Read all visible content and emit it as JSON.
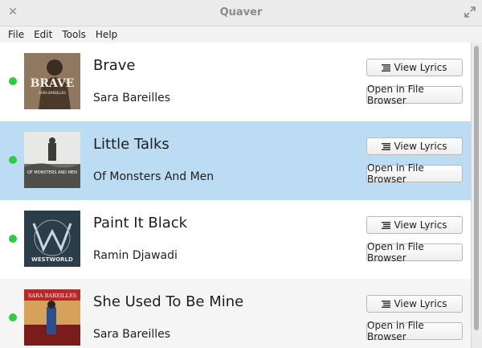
{
  "window": {
    "title": "Quaver"
  },
  "menu": [
    "File",
    "Edit",
    "Tools",
    "Help"
  ],
  "buttons": {
    "view_lyrics": "View Lyrics",
    "open_browser": "Open in File Browser"
  },
  "songs": [
    {
      "title": "Brave",
      "artist": "Sara Bareilles",
      "cover_text": "BRAVE",
      "cover_sub": "SARA BAREILLES",
      "status_color": "#2ecc40"
    },
    {
      "title": "Little Talks",
      "artist": "Of Monsters And Men",
      "cover_text": "OF MONSTERS AND MEN",
      "cover_sub": "",
      "status_color": "#2ecc40"
    },
    {
      "title": "Paint It Black",
      "artist": "Ramin Djawadi",
      "cover_text": "WESTWORLD",
      "cover_sub": "",
      "status_color": "#2ecc40"
    },
    {
      "title": "She Used To Be Mine",
      "artist": "Sara Bareilles",
      "cover_text": "SARA BAREILLES",
      "cover_sub": "",
      "status_color": "#2ecc40"
    }
  ],
  "colors": {
    "selected_row": "#bcdcf4",
    "status_dot": "#2ecc40"
  }
}
